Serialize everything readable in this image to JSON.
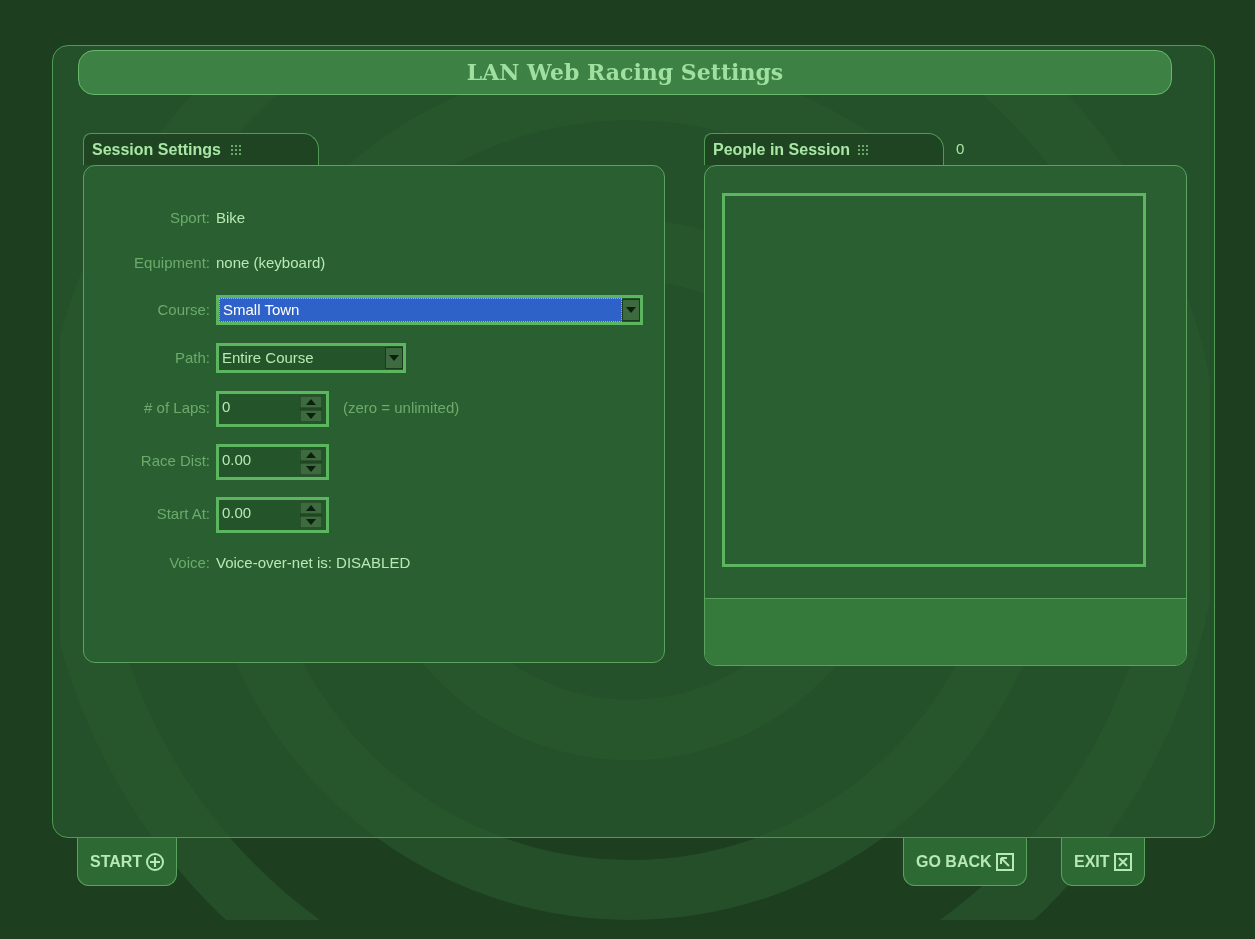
{
  "title": "LAN Web Racing Settings",
  "session_panel": {
    "tab_label": "Session Settings",
    "fields": [
      {
        "kind": "text",
        "label": "Sport:",
        "value": "Bike"
      },
      {
        "kind": "text",
        "label": "Equipment:",
        "value": "none (keyboard)"
      },
      {
        "kind": "dropdown",
        "label": "Course:",
        "value": "Small Town",
        "highlighted": true,
        "wide": true
      },
      {
        "kind": "dropdown",
        "label": "Path:",
        "value": "Entire Course",
        "highlighted": false,
        "wide": false
      },
      {
        "kind": "spinner",
        "label": "# of Laps:",
        "value": "0",
        "hint": "(zero = unlimited)"
      },
      {
        "kind": "spinner",
        "label": "Race Dist:",
        "value": "0.00"
      },
      {
        "kind": "spinner",
        "label": "Start At:",
        "value": "0.00"
      },
      {
        "kind": "text",
        "label": "Voice:",
        "value": "Voice-over-net is: DISABLED"
      }
    ]
  },
  "people_panel": {
    "tab_label": "People in Session",
    "count": "0"
  },
  "buttons": [
    {
      "kind": "start",
      "label": "START"
    },
    {
      "kind": "back",
      "label": "GO BACK"
    },
    {
      "kind": "exit",
      "label": "EXIT"
    }
  ]
}
